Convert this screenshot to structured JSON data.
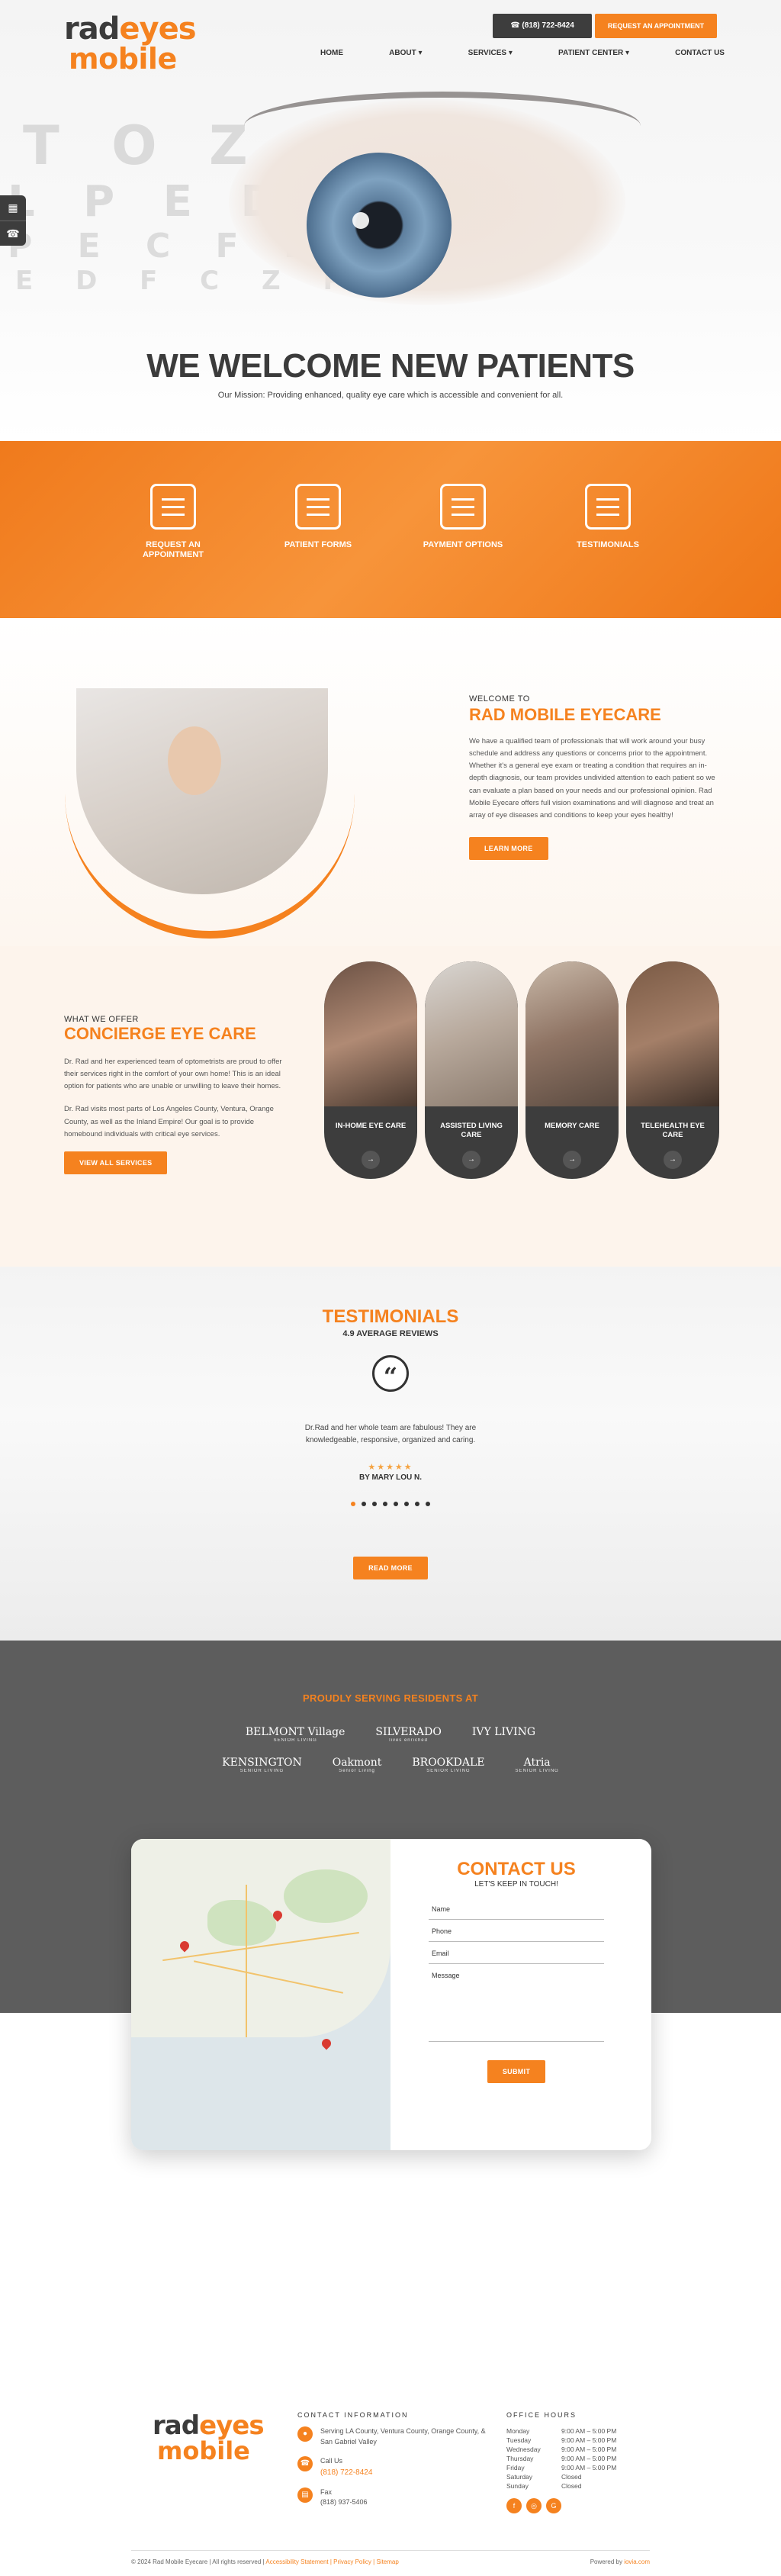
{
  "header": {
    "logo_line1_a": "rad",
    "logo_line1_b": "eyes",
    "logo_line2": "mobile",
    "phone": "(818) 722-8424",
    "appt_button": "REQUEST AN APPOINTMENT",
    "nav": [
      "HOME",
      "ABOUT ▾",
      "SERVICES ▾",
      "PATIENT CENTER ▾",
      "CONTACT US"
    ]
  },
  "hero": {
    "chart_rows": [
      "T O Z",
      "L P E D",
      "P E C F D",
      "E D F C Z P"
    ],
    "title": "WE WELCOME NEW PATIENTS",
    "subtitle": "Our Mission: Providing enhanced, quality eye care which is accessible and convenient for all."
  },
  "band": {
    "items": [
      {
        "label": "REQUEST AN APPOINTMENT"
      },
      {
        "label": "PATIENT FORMS"
      },
      {
        "label": "PAYMENT OPTIONS"
      },
      {
        "label": "TESTIMONIALS"
      }
    ]
  },
  "welcome": {
    "eyebrow": "WELCOME TO",
    "title": "RAD MOBILE EYECARE",
    "body": "We have a qualified team of professionals that will work around your busy schedule and address any questions or concerns prior to the appointment. Whether it's a general eye exam or treating a condition that requires an in-depth diagnosis, our team provides undivided attention to each patient so we can evaluate a plan based on your needs and our professional opinion. Rad Mobile Eyecare offers full vision examinations and will diagnose and treat an array of eye diseases and conditions to keep your eyes healthy!",
    "button": "LEARN MORE"
  },
  "concierge": {
    "eyebrow": "WHAT WE OFFER",
    "title": "CONCIERGE EYE CARE",
    "p1": "Dr. Rad and her experienced team of optometrists are proud to offer their services right in the comfort of your own home! This is an ideal option for patients who are unable or unwilling to leave their homes.",
    "p2": "Dr. Rad visits most parts of Los Angeles County, Ventura, Orange County, as well as the Inland Empire! Our goal is to provide homebound individuals with critical eye services.",
    "button": "VIEW ALL SERVICES",
    "cards": [
      {
        "label": "IN-HOME EYE CARE"
      },
      {
        "label": "ASSISTED LIVING CARE"
      },
      {
        "label": "MEMORY CARE"
      },
      {
        "label": "TELEHEALTH EYE CARE"
      }
    ],
    "arrow": "→"
  },
  "testimonials": {
    "title": "TESTIMONIALS",
    "average": "4.9 AVERAGE REVIEWS",
    "quote_mark": "“",
    "text": "Dr.Rad and her whole team are fabulous! They are knowledgeable, responsive, organized and caring.",
    "stars": "★★★★★",
    "by": "BY MARY LOU N.",
    "button": "READ MORE"
  },
  "serving": {
    "title": "PROUDLY SERVING RESIDENTS AT",
    "row1": [
      {
        "name": "BELMONT Village",
        "tag": "SENIOR LIVING"
      },
      {
        "name": "SILVERADO",
        "tag": "lives enriched"
      },
      {
        "name": "IVY LIVING",
        "tag": ""
      }
    ],
    "row2": [
      {
        "name": "KENSINGTON",
        "tag": "SENIOR LIVING"
      },
      {
        "name": "Oakmont",
        "tag": "Senior Living"
      },
      {
        "name": "BROOKDALE",
        "tag": "SENIOR LIVING"
      },
      {
        "name": "Atria",
        "tag": "SENIOR LIVING"
      }
    ]
  },
  "contact": {
    "title": "CONTACT US",
    "subtitle": "LET'S KEEP IN TOUCH!",
    "fields": {
      "name": "Name",
      "phone": "Phone",
      "email": "Email",
      "message": "Message"
    },
    "submit": "SUBMIT"
  },
  "footer": {
    "logo_line1_a": "rad",
    "logo_line1_b": "eyes",
    "logo_line2": "mobile",
    "info_title": "CONTACT INFORMATION",
    "area": "Serving LA County, Ventura County, Orange County, & San Gabriel Valley",
    "call_label": "Call Us",
    "call": "(818) 722-8424",
    "fax_label": "Fax",
    "fax": "(818) 937-5406",
    "hours_title": "OFFICE HOURS",
    "hours": [
      {
        "day": "Monday",
        "time": "9:00 AM – 5:00 PM"
      },
      {
        "day": "Tuesday",
        "time": "9:00 AM – 5:00 PM"
      },
      {
        "day": "Wednesday",
        "time": "9:00 AM – 5:00 PM"
      },
      {
        "day": "Thursday",
        "time": "9:00 AM – 5:00 PM"
      },
      {
        "day": "Friday",
        "time": "9:00 AM – 5:00 PM"
      },
      {
        "day": "Saturday",
        "time": "Closed"
      },
      {
        "day": "Sunday",
        "time": "Closed"
      }
    ],
    "social": [
      "f",
      "◎",
      "G"
    ],
    "copyright": "© 2024 Rad Mobile Eyecare | All rights reserved |",
    "links": "Accessibility Statement | Privacy Policy | Sitemap",
    "powered": "Powered by",
    "powered_brand": "iovia.com"
  }
}
